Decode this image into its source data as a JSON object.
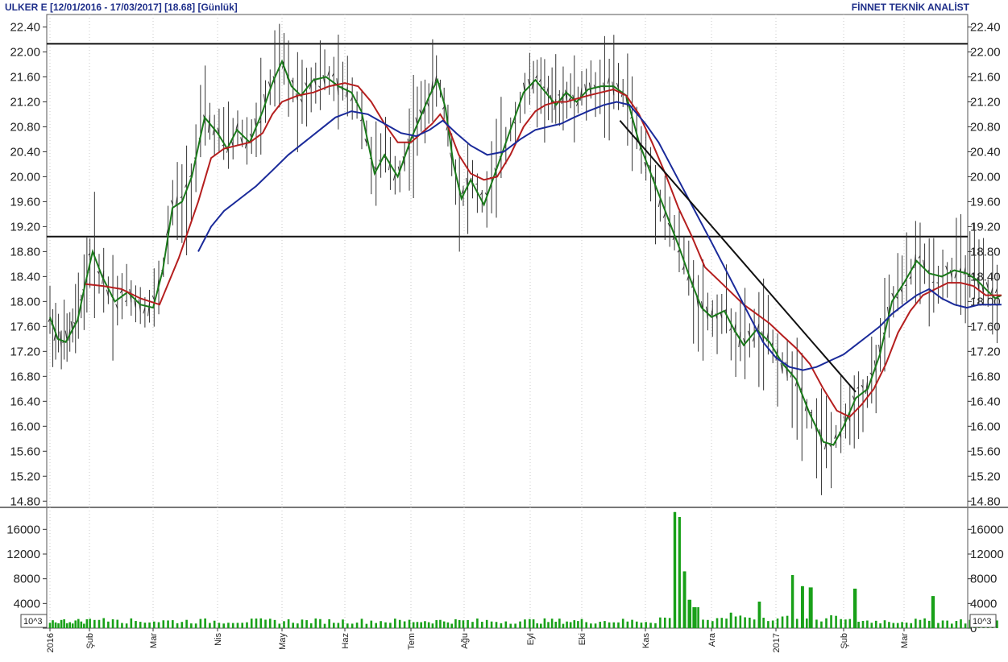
{
  "header": {
    "title": "ULKER E  [12/01/2016 - 17/03/2017]  [18.68]  [Günlük]",
    "brand": "FİNNET TEKNİK ANALİST"
  },
  "chart_data": [
    {
      "type": "candlestick",
      "panel": "price",
      "y_ticks": [
        "22.40",
        "22.00",
        "21.60",
        "21.20",
        "20.80",
        "20.40",
        "20.00",
        "19.60",
        "19.20",
        "18.80",
        "18.40",
        "18.00",
        "17.60",
        "17.20",
        "16.80",
        "16.40",
        "16.00",
        "15.60",
        "15.20",
        "14.80"
      ],
      "ylim": [
        14.7,
        22.6
      ],
      "x_labels": [
        "2016",
        "Şub",
        "Mar",
        "Nis",
        "May",
        "Haz",
        "Tem",
        "Ağu",
        "Eyl",
        "Eki",
        "Kas",
        "Ara",
        "2017",
        "Şub",
        "Mar"
      ],
      "last_price": 18.68,
      "horizontal_lines": [
        22.13,
        19.04
      ],
      "trend_line": {
        "from": [
          9.6,
          20.9
        ],
        "to": [
          13.2,
          16.55
        ]
      },
      "series": [
        {
          "name": "",
          "color": "#1a7a1a",
          "points": [
            [
              0,
              17.75
            ],
            [
              0.2,
              17.4
            ],
            [
              0.4,
              17.35
            ],
            [
              0.7,
              17.7
            ],
            [
              0.9,
              18.3
            ],
            [
              1.05,
              18.8
            ],
            [
              1.2,
              18.4
            ],
            [
              1.4,
              18.0
            ],
            [
              1.6,
              18.15
            ],
            [
              1.8,
              17.95
            ],
            [
              2.0,
              17.9
            ],
            [
              2.15,
              18.5
            ],
            [
              2.3,
              19.5
            ],
            [
              2.45,
              19.6
            ],
            [
              2.6,
              20.0
            ],
            [
              2.8,
              20.95
            ],
            [
              3.0,
              20.7
            ],
            [
              3.15,
              20.45
            ],
            [
              3.3,
              20.75
            ],
            [
              3.5,
              20.55
            ],
            [
              3.7,
              21.05
            ],
            [
              3.85,
              21.5
            ],
            [
              4.0,
              21.85
            ],
            [
              4.15,
              21.45
            ],
            [
              4.3,
              21.3
            ],
            [
              4.5,
              21.55
            ],
            [
              4.7,
              21.6
            ],
            [
              4.9,
              21.45
            ],
            [
              5.1,
              21.35
            ],
            [
              5.25,
              21.05
            ],
            [
              5.45,
              20.05
            ],
            [
              5.6,
              20.35
            ],
            [
              5.8,
              20.0
            ],
            [
              6.0,
              20.6
            ],
            [
              6.15,
              20.9
            ],
            [
              6.35,
              21.3
            ],
            [
              6.5,
              21.55
            ],
            [
              6.65,
              21.1
            ],
            [
              6.8,
              20.2
            ],
            [
              6.95,
              19.65
            ],
            [
              7.1,
              19.95
            ],
            [
              7.3,
              19.55
            ],
            [
              7.5,
              20.15
            ],
            [
              7.7,
              20.75
            ],
            [
              7.9,
              21.35
            ],
            [
              8.1,
              21.55
            ],
            [
              8.3,
              21.35
            ],
            [
              8.5,
              21.15
            ],
            [
              8.7,
              21.35
            ],
            [
              8.9,
              21.2
            ],
            [
              9.1,
              21.4
            ],
            [
              9.3,
              21.45
            ],
            [
              9.5,
              21.45
            ],
            [
              9.7,
              21.3
            ],
            [
              9.9,
              20.55
            ],
            [
              10.1,
              20.0
            ],
            [
              10.3,
              19.45
            ],
            [
              10.5,
              18.9
            ],
            [
              10.7,
              18.3
            ],
            [
              10.85,
              17.9
            ],
            [
              11.0,
              17.75
            ],
            [
              11.2,
              17.85
            ],
            [
              11.35,
              17.55
            ],
            [
              11.5,
              17.3
            ],
            [
              11.7,
              17.55
            ],
            [
              11.9,
              17.35
            ],
            [
              12.1,
              17.0
            ],
            [
              12.3,
              16.75
            ],
            [
              12.5,
              16.2
            ],
            [
              12.7,
              15.75
            ],
            [
              12.85,
              15.7
            ],
            [
              13.0,
              16.0
            ],
            [
              13.2,
              16.45
            ],
            [
              13.4,
              16.6
            ],
            [
              13.6,
              17.15
            ],
            [
              13.8,
              18.0
            ],
            [
              14.0,
              18.3
            ],
            [
              14.2,
              18.65
            ],
            [
              14.4,
              18.45
            ],
            [
              14.6,
              18.4
            ],
            [
              14.8,
              18.5
            ],
            [
              15.0,
              18.45
            ],
            [
              15.15,
              18.35
            ],
            [
              15.3,
              18.2
            ],
            [
              15.45,
              18.05
            ],
            [
              15.55,
              18.1
            ]
          ]
        },
        {
          "name": "",
          "color": "#b51f1f",
          "points": [
            [
              0.9,
              18.28
            ],
            [
              1.2,
              18.25
            ],
            [
              1.5,
              18.2
            ],
            [
              1.8,
              18.05
            ],
            [
              2.1,
              17.95
            ],
            [
              2.4,
              18.7
            ],
            [
              2.7,
              19.6
            ],
            [
              2.9,
              20.3
            ],
            [
              3.1,
              20.45
            ],
            [
              3.3,
              20.5
            ],
            [
              3.5,
              20.55
            ],
            [
              3.7,
              20.7
            ],
            [
              3.85,
              21.0
            ],
            [
              4.0,
              21.2
            ],
            [
              4.25,
              21.3
            ],
            [
              4.5,
              21.35
            ],
            [
              4.75,
              21.45
            ],
            [
              5.0,
              21.5
            ],
            [
              5.2,
              21.45
            ],
            [
              5.4,
              21.2
            ],
            [
              5.6,
              20.85
            ],
            [
              5.8,
              20.55
            ],
            [
              6.0,
              20.55
            ],
            [
              6.2,
              20.7
            ],
            [
              6.4,
              20.85
            ],
            [
              6.55,
              21.0
            ],
            [
              6.7,
              20.8
            ],
            [
              6.9,
              20.35
            ],
            [
              7.1,
              20.05
            ],
            [
              7.3,
              19.95
            ],
            [
              7.5,
              20.0
            ],
            [
              7.7,
              20.35
            ],
            [
              7.9,
              20.8
            ],
            [
              8.1,
              21.05
            ],
            [
              8.3,
              21.15
            ],
            [
              8.5,
              21.2
            ],
            [
              8.7,
              21.2
            ],
            [
              8.9,
              21.25
            ],
            [
              9.1,
              21.3
            ],
            [
              9.3,
              21.35
            ],
            [
              9.5,
              21.4
            ],
            [
              9.7,
              21.3
            ],
            [
              9.9,
              21.0
            ],
            [
              10.1,
              20.55
            ],
            [
              10.3,
              20.05
            ],
            [
              10.5,
              19.5
            ],
            [
              10.7,
              19.05
            ],
            [
              10.9,
              18.55
            ],
            [
              11.1,
              18.35
            ],
            [
              11.3,
              18.15
            ],
            [
              11.5,
              17.95
            ],
            [
              11.7,
              17.8
            ],
            [
              11.9,
              17.65
            ],
            [
              12.1,
              17.45
            ],
            [
              12.3,
              17.25
            ],
            [
              12.5,
              17.0
            ],
            [
              12.7,
              16.6
            ],
            [
              12.9,
              16.25
            ],
            [
              13.1,
              16.15
            ],
            [
              13.3,
              16.35
            ],
            [
              13.5,
              16.6
            ],
            [
              13.7,
              17.0
            ],
            [
              13.9,
              17.5
            ],
            [
              14.1,
              17.85
            ],
            [
              14.3,
              18.1
            ],
            [
              14.5,
              18.2
            ],
            [
              14.7,
              18.3
            ],
            [
              14.9,
              18.3
            ],
            [
              15.1,
              18.25
            ],
            [
              15.3,
              18.1
            ],
            [
              15.55,
              18.1
            ]
          ]
        },
        {
          "name": "",
          "color": "#1a2a9a",
          "points": [
            [
              2.7,
              18.8
            ],
            [
              2.9,
              19.2
            ],
            [
              3.1,
              19.45
            ],
            [
              3.35,
              19.65
            ],
            [
              3.6,
              19.85
            ],
            [
              3.85,
              20.1
            ],
            [
              4.1,
              20.35
            ],
            [
              4.35,
              20.55
            ],
            [
              4.6,
              20.75
            ],
            [
              4.85,
              20.95
            ],
            [
              5.1,
              21.05
            ],
            [
              5.35,
              21.0
            ],
            [
              5.6,
              20.85
            ],
            [
              5.85,
              20.7
            ],
            [
              6.1,
              20.65
            ],
            [
              6.35,
              20.75
            ],
            [
              6.6,
              20.9
            ],
            [
              6.85,
              20.7
            ],
            [
              7.1,
              20.5
            ],
            [
              7.35,
              20.35
            ],
            [
              7.6,
              20.4
            ],
            [
              7.85,
              20.6
            ],
            [
              8.1,
              20.75
            ],
            [
              8.35,
              20.8
            ],
            [
              8.6,
              20.85
            ],
            [
              8.85,
              20.95
            ],
            [
              9.1,
              21.05
            ],
            [
              9.35,
              21.15
            ],
            [
              9.55,
              21.2
            ],
            [
              9.75,
              21.15
            ],
            [
              10.0,
              20.85
            ],
            [
              10.2,
              20.55
            ],
            [
              10.4,
              20.15
            ],
            [
              10.6,
              19.75
            ],
            [
              10.8,
              19.35
            ],
            [
              11.0,
              18.95
            ],
            [
              11.2,
              18.55
            ],
            [
              11.4,
              18.15
            ],
            [
              11.6,
              17.75
            ],
            [
              11.8,
              17.35
            ],
            [
              12.0,
              17.1
            ],
            [
              12.2,
              16.95
            ],
            [
              12.4,
              16.9
            ],
            [
              12.6,
              16.95
            ],
            [
              12.8,
              17.05
            ],
            [
              13.0,
              17.15
            ],
            [
              13.2,
              17.3
            ],
            [
              13.4,
              17.45
            ],
            [
              13.6,
              17.6
            ],
            [
              13.8,
              17.8
            ],
            [
              14.0,
              17.95
            ],
            [
              14.2,
              18.1
            ],
            [
              14.4,
              18.2
            ],
            [
              14.6,
              18.05
            ],
            [
              14.8,
              17.95
            ],
            [
              15.0,
              17.9
            ],
            [
              15.2,
              17.95
            ],
            [
              15.4,
              17.95
            ],
            [
              15.55,
              17.95
            ]
          ]
        }
      ]
    },
    {
      "type": "bar",
      "panel": "volume",
      "unit": "10^3",
      "y_ticks": [
        "16000",
        "12000",
        "8000",
        "4000",
        "0"
      ],
      "ylim": [
        0,
        19300
      ],
      "spikes": [
        [
          10.45,
          18800
        ],
        [
          10.52,
          18000
        ],
        [
          10.6,
          9200
        ],
        [
          10.68,
          4600
        ],
        [
          10.76,
          3400
        ],
        [
          11.3,
          2500
        ],
        [
          11.75,
          4300
        ],
        [
          12.25,
          8600
        ],
        [
          12.4,
          6800
        ],
        [
          12.5,
          6600
        ],
        [
          13.2,
          6400
        ],
        [
          14.45,
          5200
        ]
      ],
      "series": [
        {
          "name": "",
          "color": "#18a018"
        }
      ]
    }
  ]
}
